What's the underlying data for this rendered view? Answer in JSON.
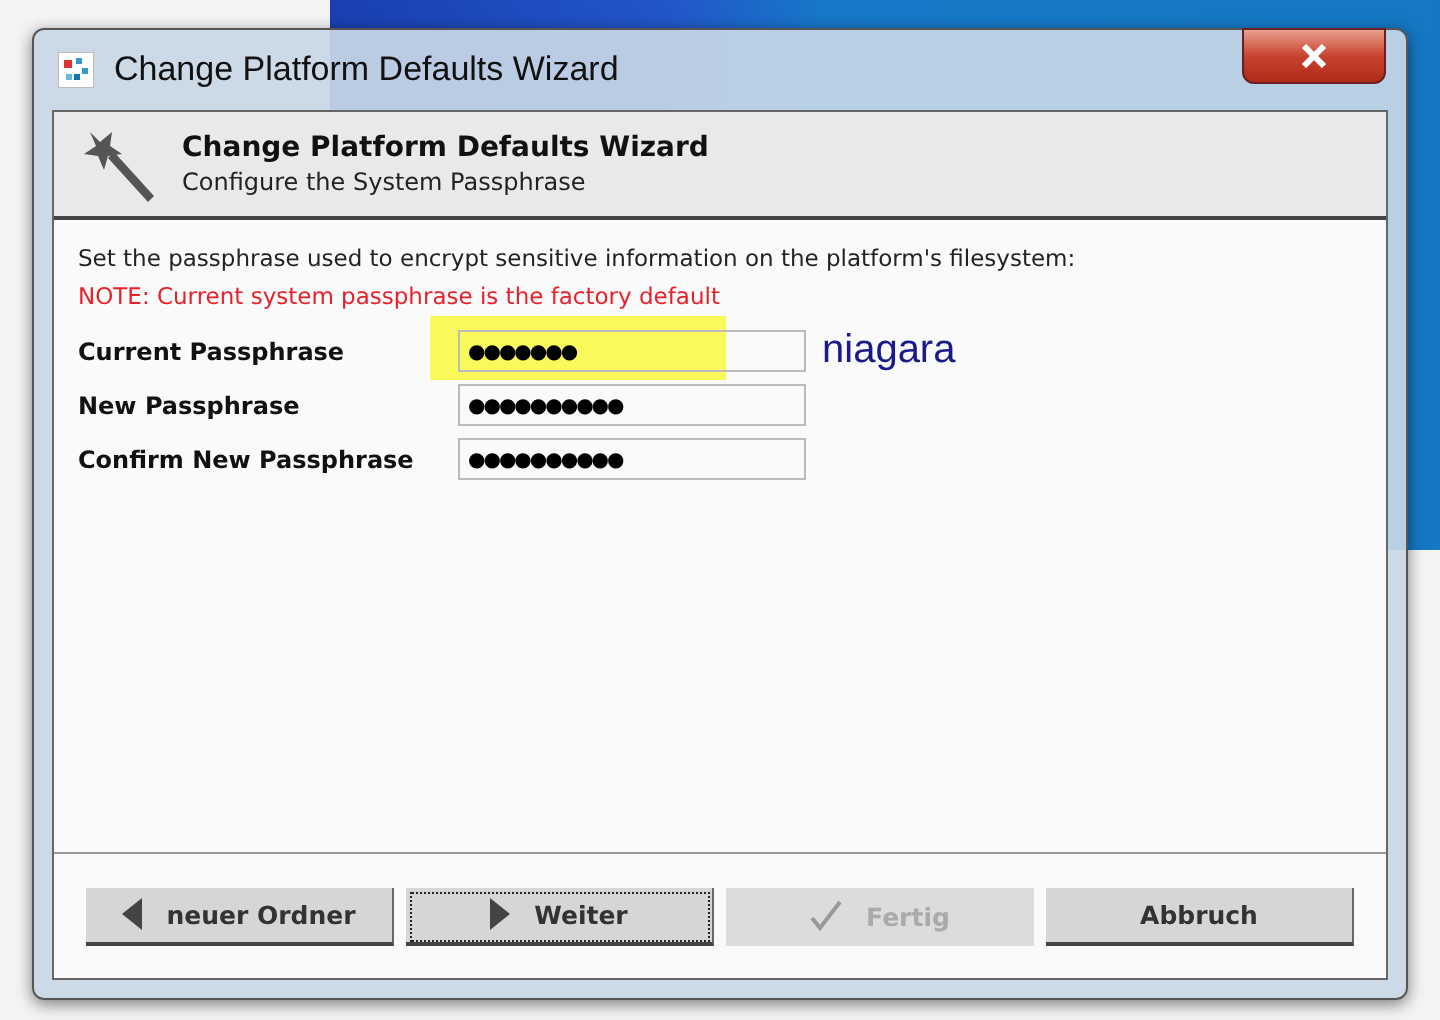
{
  "window": {
    "title": "Change Platform Defaults Wizard"
  },
  "header": {
    "title": "Change Platform Defaults Wizard",
    "subtitle": "Configure the System Passphrase"
  },
  "intro": "Set the passphrase used to encrypt sensitive information on the platform's filesystem:",
  "note": "NOTE: Current system passphrase is the factory default",
  "fields": [
    {
      "label": "Current Passphrase",
      "value": "●●●●●●●",
      "highlighted": true,
      "annotation": "niagara"
    },
    {
      "label": "New Passphrase",
      "value": "●●●●●●●●●●",
      "highlighted": false
    },
    {
      "label": "Confirm New Passphrase",
      "value": "●●●●●●●●●●",
      "highlighted": false
    }
  ],
  "buttons": [
    {
      "label": "neuer Ordner",
      "kind": "back",
      "disabled": false,
      "focused": false
    },
    {
      "label": "Weiter",
      "kind": "next",
      "disabled": false,
      "focused": true
    },
    {
      "label": "Fertig",
      "kind": "finish",
      "disabled": true,
      "focused": false
    },
    {
      "label": "Abbruch",
      "kind": "cancel",
      "disabled": false,
      "focused": false
    }
  ]
}
